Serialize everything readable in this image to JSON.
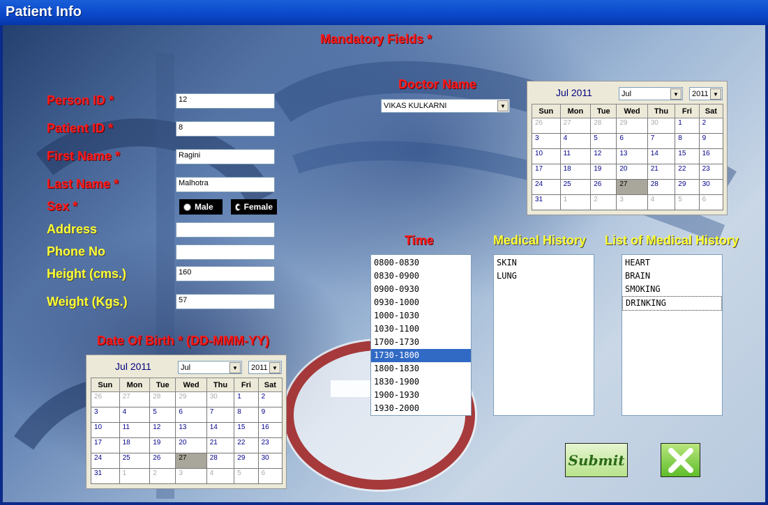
{
  "window": {
    "title": "Patient Info"
  },
  "mandatory_note": "Mandatory Fields *",
  "labels": {
    "person_id": "Person ID *",
    "patient_id": "Patient ID *",
    "first_name": "First Name *",
    "last_name": "Last Name *",
    "sex": "Sex *",
    "address": "Address",
    "phone": "Phone No",
    "height": "Height (cms.)",
    "weight": "Weight (Kgs.)",
    "dob": "Date Of Birth * (DD-MMM-YY)",
    "doctor": "Doctor Name",
    "time": "Time",
    "medical_history": "Medical History",
    "list_medical_history": "List of Medical History"
  },
  "fields": {
    "person_id": "12",
    "patient_id": "8",
    "first_name": "Ragini",
    "last_name": "Malhotra",
    "address": "",
    "phone": "",
    "height": "160",
    "weight": "57"
  },
  "sex": {
    "male": "Male",
    "female": "Female",
    "selected": "Female"
  },
  "doctor": {
    "selected": "VIKAS KULKARNI"
  },
  "time_slots": [
    "0800-0830",
    "0830-0900",
    "0900-0930",
    "0930-1000",
    "1000-1030",
    "1030-1100",
    "1700-1730",
    "1730-1800",
    "1800-1830",
    "1830-1900",
    "1900-1930",
    "1930-2000"
  ],
  "time_selected": "1730-1800",
  "medical_history": [
    "SKIN",
    "LUNG"
  ],
  "medical_history_list": [
    "HEART",
    "BRAIN",
    "SMOKING",
    "DRINKING"
  ],
  "medical_history_list_focused": "DRINKING",
  "calendar": {
    "month_title": "Jul 2011",
    "month_select": "Jul",
    "year_select": "2011",
    "weekdays": [
      "Sun",
      "Mon",
      "Tue",
      "Wed",
      "Thu",
      "Fri",
      "Sat"
    ],
    "today": "27",
    "weeks": [
      [
        "26",
        "27",
        "28",
        "29",
        "30",
        "1",
        "2"
      ],
      [
        "3",
        "4",
        "5",
        "6",
        "7",
        "8",
        "9"
      ],
      [
        "10",
        "11",
        "12",
        "13",
        "14",
        "15",
        "16"
      ],
      [
        "17",
        "18",
        "19",
        "20",
        "21",
        "22",
        "23"
      ],
      [
        "24",
        "25",
        "26",
        "27",
        "28",
        "29",
        "30"
      ],
      [
        "31",
        "1",
        "2",
        "3",
        "4",
        "5",
        "6"
      ]
    ]
  },
  "buttons": {
    "submit": "Submit"
  },
  "colors": {
    "required": "#ff1a1a",
    "optional": "#ffff33",
    "selection": "#316ac5"
  }
}
